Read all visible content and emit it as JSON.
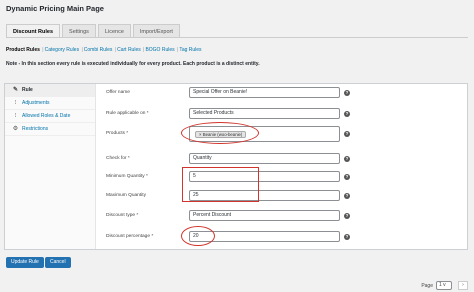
{
  "page": {
    "title": "Dynamic Pricing Main Page"
  },
  "tabs": [
    {
      "label": "Discount Rules"
    },
    {
      "label": "Settings"
    },
    {
      "label": "Licence"
    },
    {
      "label": "Import/Export"
    }
  ],
  "subnav": {
    "current": "Product Rules",
    "links": [
      "Category Rules",
      "Combi Rules",
      "Cart Rules",
      "BOGO Rules",
      "Tag Rules"
    ]
  },
  "note": "Note - In this section every rule is executed individually for every product. Each product is a distinct entity.",
  "sidebar": {
    "items": [
      {
        "label": "Rule",
        "icon": "wrench-icon"
      },
      {
        "label": "Adjustments",
        "icon": "dots-icon"
      },
      {
        "label": "Allowed Roles & Date",
        "icon": "dots-icon"
      },
      {
        "label": "Restrictions",
        "icon": "gear-icon"
      }
    ]
  },
  "form": {
    "offer_name": {
      "label": "Offer name",
      "value": "Special Offer on Beanie!"
    },
    "rule_applicable_on": {
      "label": "Rule applicable on *",
      "value": "Selected Products"
    },
    "products": {
      "label": "Products *",
      "chip": "× Beanie (woo-beanie)"
    },
    "check_for": {
      "label": "Check for *",
      "value": "Quantity"
    },
    "minimum_quantity": {
      "label": "Minimum Quantity *",
      "value": "5"
    },
    "maximum_quantity": {
      "label": "Maximum Quantity",
      "value": "25"
    },
    "discount_type": {
      "label": "Discount type *",
      "value": "Percent Discount"
    },
    "discount_percentage": {
      "label": "Discount percentage *",
      "value": "20"
    }
  },
  "buttons": {
    "update": "Update Rule",
    "cancel": "Cancel"
  },
  "pager": {
    "label": "Page",
    "value": "1",
    "chev": "v",
    "arrow": "›"
  },
  "icons": {
    "help": "?",
    "chevron": "⌄"
  },
  "colors": {
    "accent": "#2271b1",
    "highlight": "#d0342c",
    "link": "#0073aa"
  }
}
